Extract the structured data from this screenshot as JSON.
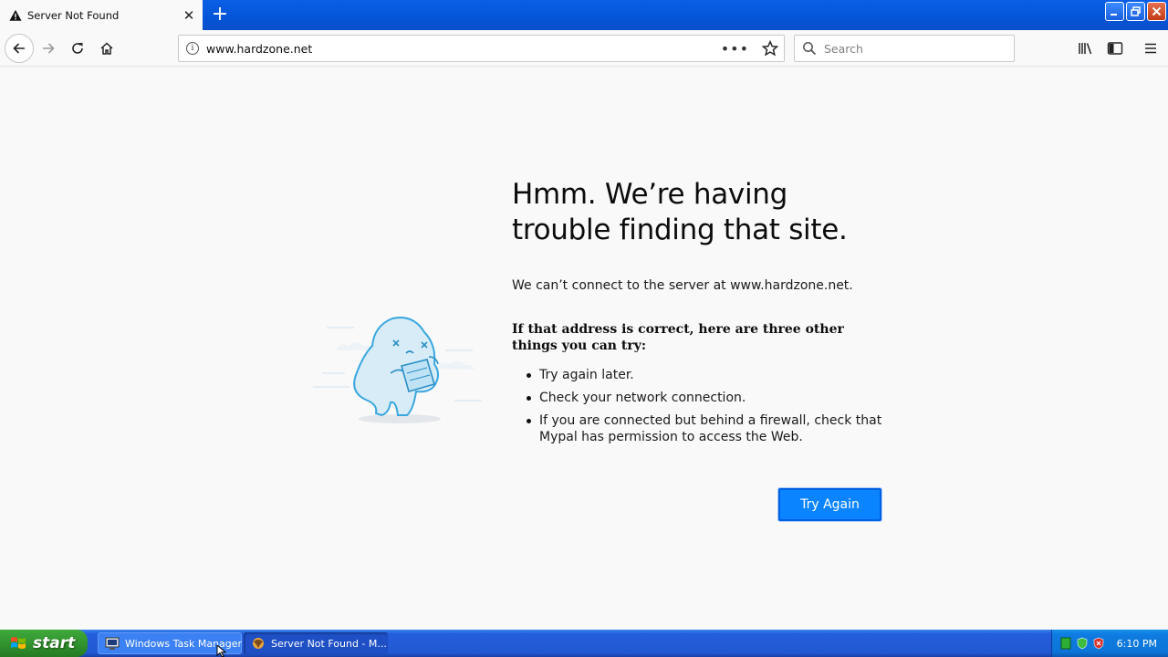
{
  "browser": {
    "tab_title": "Server Not Found",
    "new_tab_symbol": "+",
    "url": "www.hardzone.net",
    "search_placeholder": "Search",
    "window_buttons": [
      "minimize",
      "restore",
      "close"
    ]
  },
  "error_page": {
    "title": "Hmm. We’re having trouble finding that site.",
    "description": "We can’t connect to the server at www.hardzone.net.",
    "suggestion_heading": "If that address is correct, here are three other things you can try:",
    "suggestions": [
      "Try again later.",
      "Check your network connection.",
      "If you are connected but behind a firewall, check that Mypal has permission to access the Web."
    ],
    "try_again_label": "Try Again"
  },
  "taskbar": {
    "start_label": "start",
    "tasks": [
      {
        "label": "Windows Task Manager",
        "icon": "task-manager-icon"
      },
      {
        "label": "Server Not Found - M...",
        "icon": "mypal-browser-icon"
      }
    ],
    "clock": "6:10 PM"
  },
  "colors": {
    "accent_blue": "#0a84ff",
    "xp_taskbar": "#245edb",
    "xp_start_green": "#2f8f2d"
  }
}
